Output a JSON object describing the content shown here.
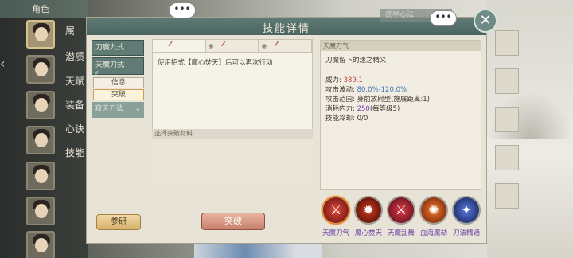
{
  "left_panel": {
    "header": "角色",
    "labels": [
      "属",
      "潜质",
      "天赋",
      "装备",
      "心诀",
      "技能"
    ]
  },
  "dialog": {
    "title": "技能详情",
    "close_label": "✕",
    "wuxue_tab": "武学心法",
    "chat_label": "•••"
  },
  "skill_tabs": [
    {
      "label": "刀魔九式",
      "stars": "⁄⁄⁄"
    },
    {
      "label": "天魔刀式",
      "stars": "⁄⁄⁄"
    }
  ],
  "sub_buttons": {
    "info": "信息",
    "breakthrough": "突破"
  },
  "cannot_tab": {
    "label": "寂天刀法",
    "chevron": "⌄"
  },
  "canyan_button": "参研",
  "center": {
    "tabs": [
      "⁄⁄⁄",
      "⁄⁄⁄",
      "⁄⁄⁄"
    ],
    "description": "使用招式【魔心焚天】后可以再次行动",
    "material_label": "选择突破材料",
    "breakthrough_button": "突破"
  },
  "detail": {
    "head": "天魔刀气",
    "subtitle": "刀魔留下的迷之精义",
    "stats": [
      {
        "label": "威力: ",
        "value": "389.1",
        "cls": "v-red"
      },
      {
        "label": "攻击波动: ",
        "value": "80.0%-120.0%",
        "cls": "v-blue"
      },
      {
        "label": "攻击范围: 身前放射型(施展距离:1)",
        "value": "",
        "cls": ""
      },
      {
        "label": "消耗内力: ",
        "value": "250",
        "suffix": "(每等级5)",
        "cls": "v-violet"
      },
      {
        "label": "技能冷却: 0/0",
        "value": "",
        "cls": ""
      }
    ]
  },
  "skills": [
    {
      "name": "天魔刀气",
      "glyph": "⚔",
      "color": "#b8292a"
    },
    {
      "name": "魔心焚天",
      "glyph": "✹",
      "color": "#8f1f14"
    },
    {
      "name": "天魔乱舞",
      "glyph": "⚔",
      "color": "#a12030"
    },
    {
      "name": "血海魔劫",
      "glyph": "✺",
      "color": "#c2481c"
    },
    {
      "name": "刀法精通",
      "glyph": "✦",
      "color": "#2f4aa0"
    }
  ],
  "colors": {
    "accent": "#5f7b74",
    "skill_label": "#6a3fa6",
    "power": "#c2433b"
  }
}
